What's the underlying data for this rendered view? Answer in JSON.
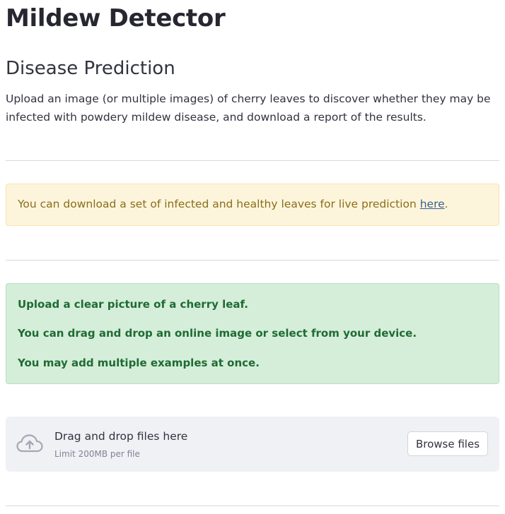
{
  "app": {
    "title": "Mildew Detector"
  },
  "section": {
    "title": "Disease Prediction",
    "intro": "Upload an image (or multiple images) of cherry leaves to discover whether they may be infected with powdery mildew disease, and download a report of the results."
  },
  "info_banner": {
    "text": "You can download a set of infected and healthy leaves for live prediction ",
    "link_text": "here",
    "suffix": "."
  },
  "instructions": {
    "lines": [
      "Upload a clear picture of a cherry leaf.",
      "You can drag and drop an online image or select from your device.",
      "You may add multiple examples at once."
    ]
  },
  "uploader": {
    "icon": "cloud-upload-icon",
    "drop_label": "Drag and drop files here",
    "limit_label": "Limit 200MB per file",
    "browse_label": "Browse files"
  },
  "colors": {
    "warning_bg": "#fdf5db",
    "warning_text": "#8a6d1c",
    "success_bg": "#d5eed9",
    "success_text": "#1f6b34",
    "uploader_bg": "#eff1f5"
  }
}
